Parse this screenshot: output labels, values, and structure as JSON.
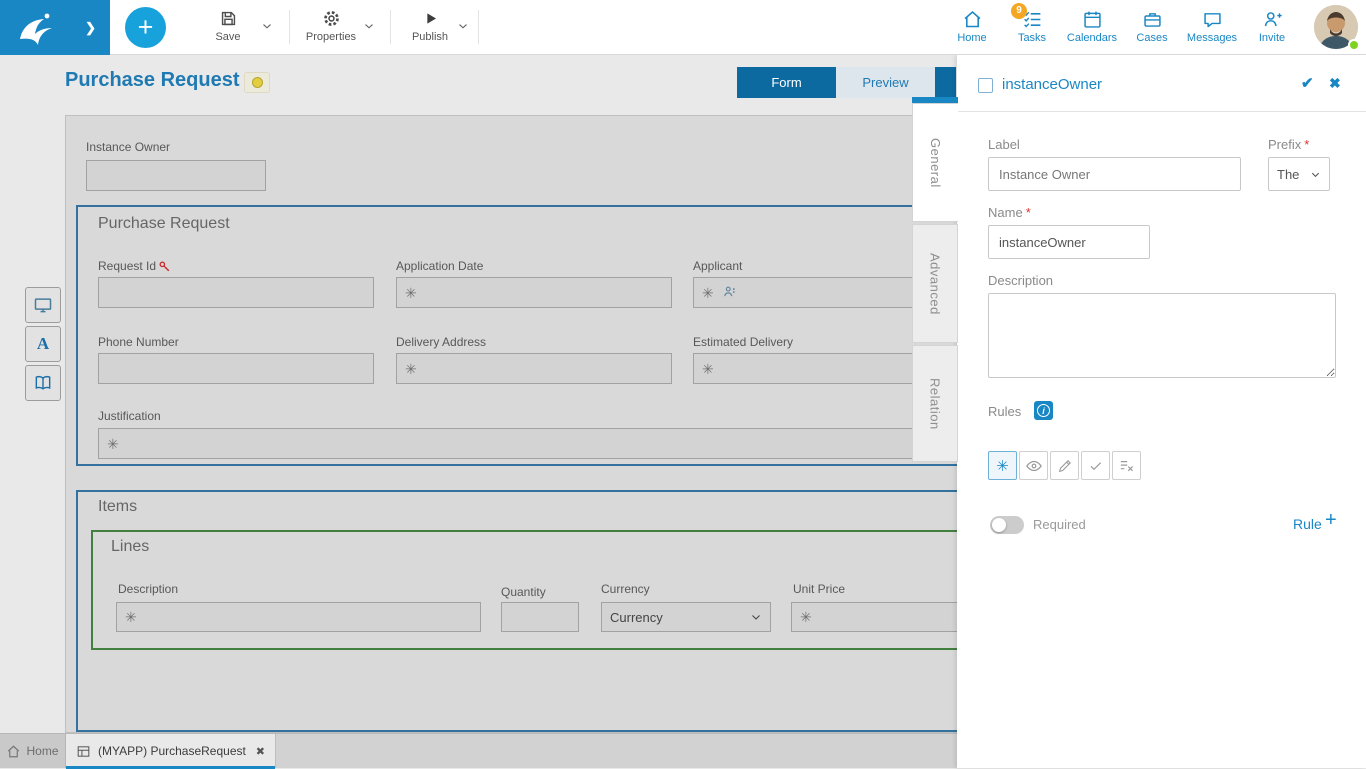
{
  "glyphs": {
    "plus": "+",
    "chevron_right": "❯",
    "asterisk": "✳",
    "check": "✔",
    "close": "✖",
    "letter_a": "A"
  },
  "colors": {
    "accent": "#1a87c5",
    "tab_active": "#0c6aa0",
    "badge": "#f5a623",
    "section_border_blue": "#35719f",
    "section_border_green": "#43803f",
    "required_star": "#dd3333"
  },
  "topbar": {
    "toolbar": [
      {
        "label": "Save"
      },
      {
        "label": "Properties"
      },
      {
        "label": "Publish"
      }
    ],
    "nav": [
      {
        "label": "Home"
      },
      {
        "label": "Tasks",
        "badge": "9"
      },
      {
        "label": "Calendars"
      },
      {
        "label": "Cases"
      },
      {
        "label": "Messages"
      },
      {
        "label": "Invite"
      }
    ]
  },
  "main": {
    "title": "Purchase Request",
    "view_tabs": [
      {
        "label": "Form"
      },
      {
        "label": "Preview"
      }
    ]
  },
  "canvas": {
    "instance_owner": {
      "label": "Instance Owner",
      "value": ""
    },
    "purchase_request_section": {
      "title": "Purchase Request",
      "fields": {
        "request_id": {
          "label": "Request Id",
          "value": ""
        },
        "application_date": {
          "label": "Application Date",
          "placeholder": "✳"
        },
        "applicant": {
          "label": "Applicant",
          "placeholder": "✳"
        },
        "phone_number": {
          "label": "Phone Number",
          "value": ""
        },
        "delivery_address": {
          "label": "Delivery Address",
          "placeholder": "✳"
        },
        "estimated_delivery": {
          "label": "Estimated Delivery",
          "placeholder": "✳"
        },
        "justification": {
          "label": "Justification",
          "placeholder": "✳"
        }
      }
    },
    "items_section": {
      "title": "Items",
      "lines_section": {
        "title": "Lines",
        "fields": {
          "description": {
            "label": "Description",
            "placeholder": "✳"
          },
          "quantity": {
            "label": "Quantity",
            "value": ""
          },
          "currency": {
            "label": "Currency",
            "selected": "Currency"
          },
          "unit_price": {
            "label": "Unit Price",
            "placeholder": "✳"
          }
        }
      }
    }
  },
  "panel": {
    "title": "instanceOwner",
    "tabs": [
      {
        "label": "General"
      },
      {
        "label": "Advanced"
      },
      {
        "label": "Relation"
      }
    ],
    "fields": {
      "label": {
        "label": "Label",
        "value": "Instance Owner"
      },
      "prefix": {
        "label": "Prefix",
        "required": "*",
        "value": "The"
      },
      "name": {
        "label": "Name",
        "required": "*",
        "value": "instanceOwner"
      },
      "description": {
        "label": "Description",
        "value": ""
      }
    },
    "rules": {
      "label": "Rules"
    },
    "required_toggle": {
      "label": "Required"
    },
    "rule_link": {
      "label": "Rule",
      "plus": "+"
    }
  },
  "bottombar": {
    "home_label": "Home",
    "active_tab_label": "(MYAPP) PurchaseRequest"
  }
}
